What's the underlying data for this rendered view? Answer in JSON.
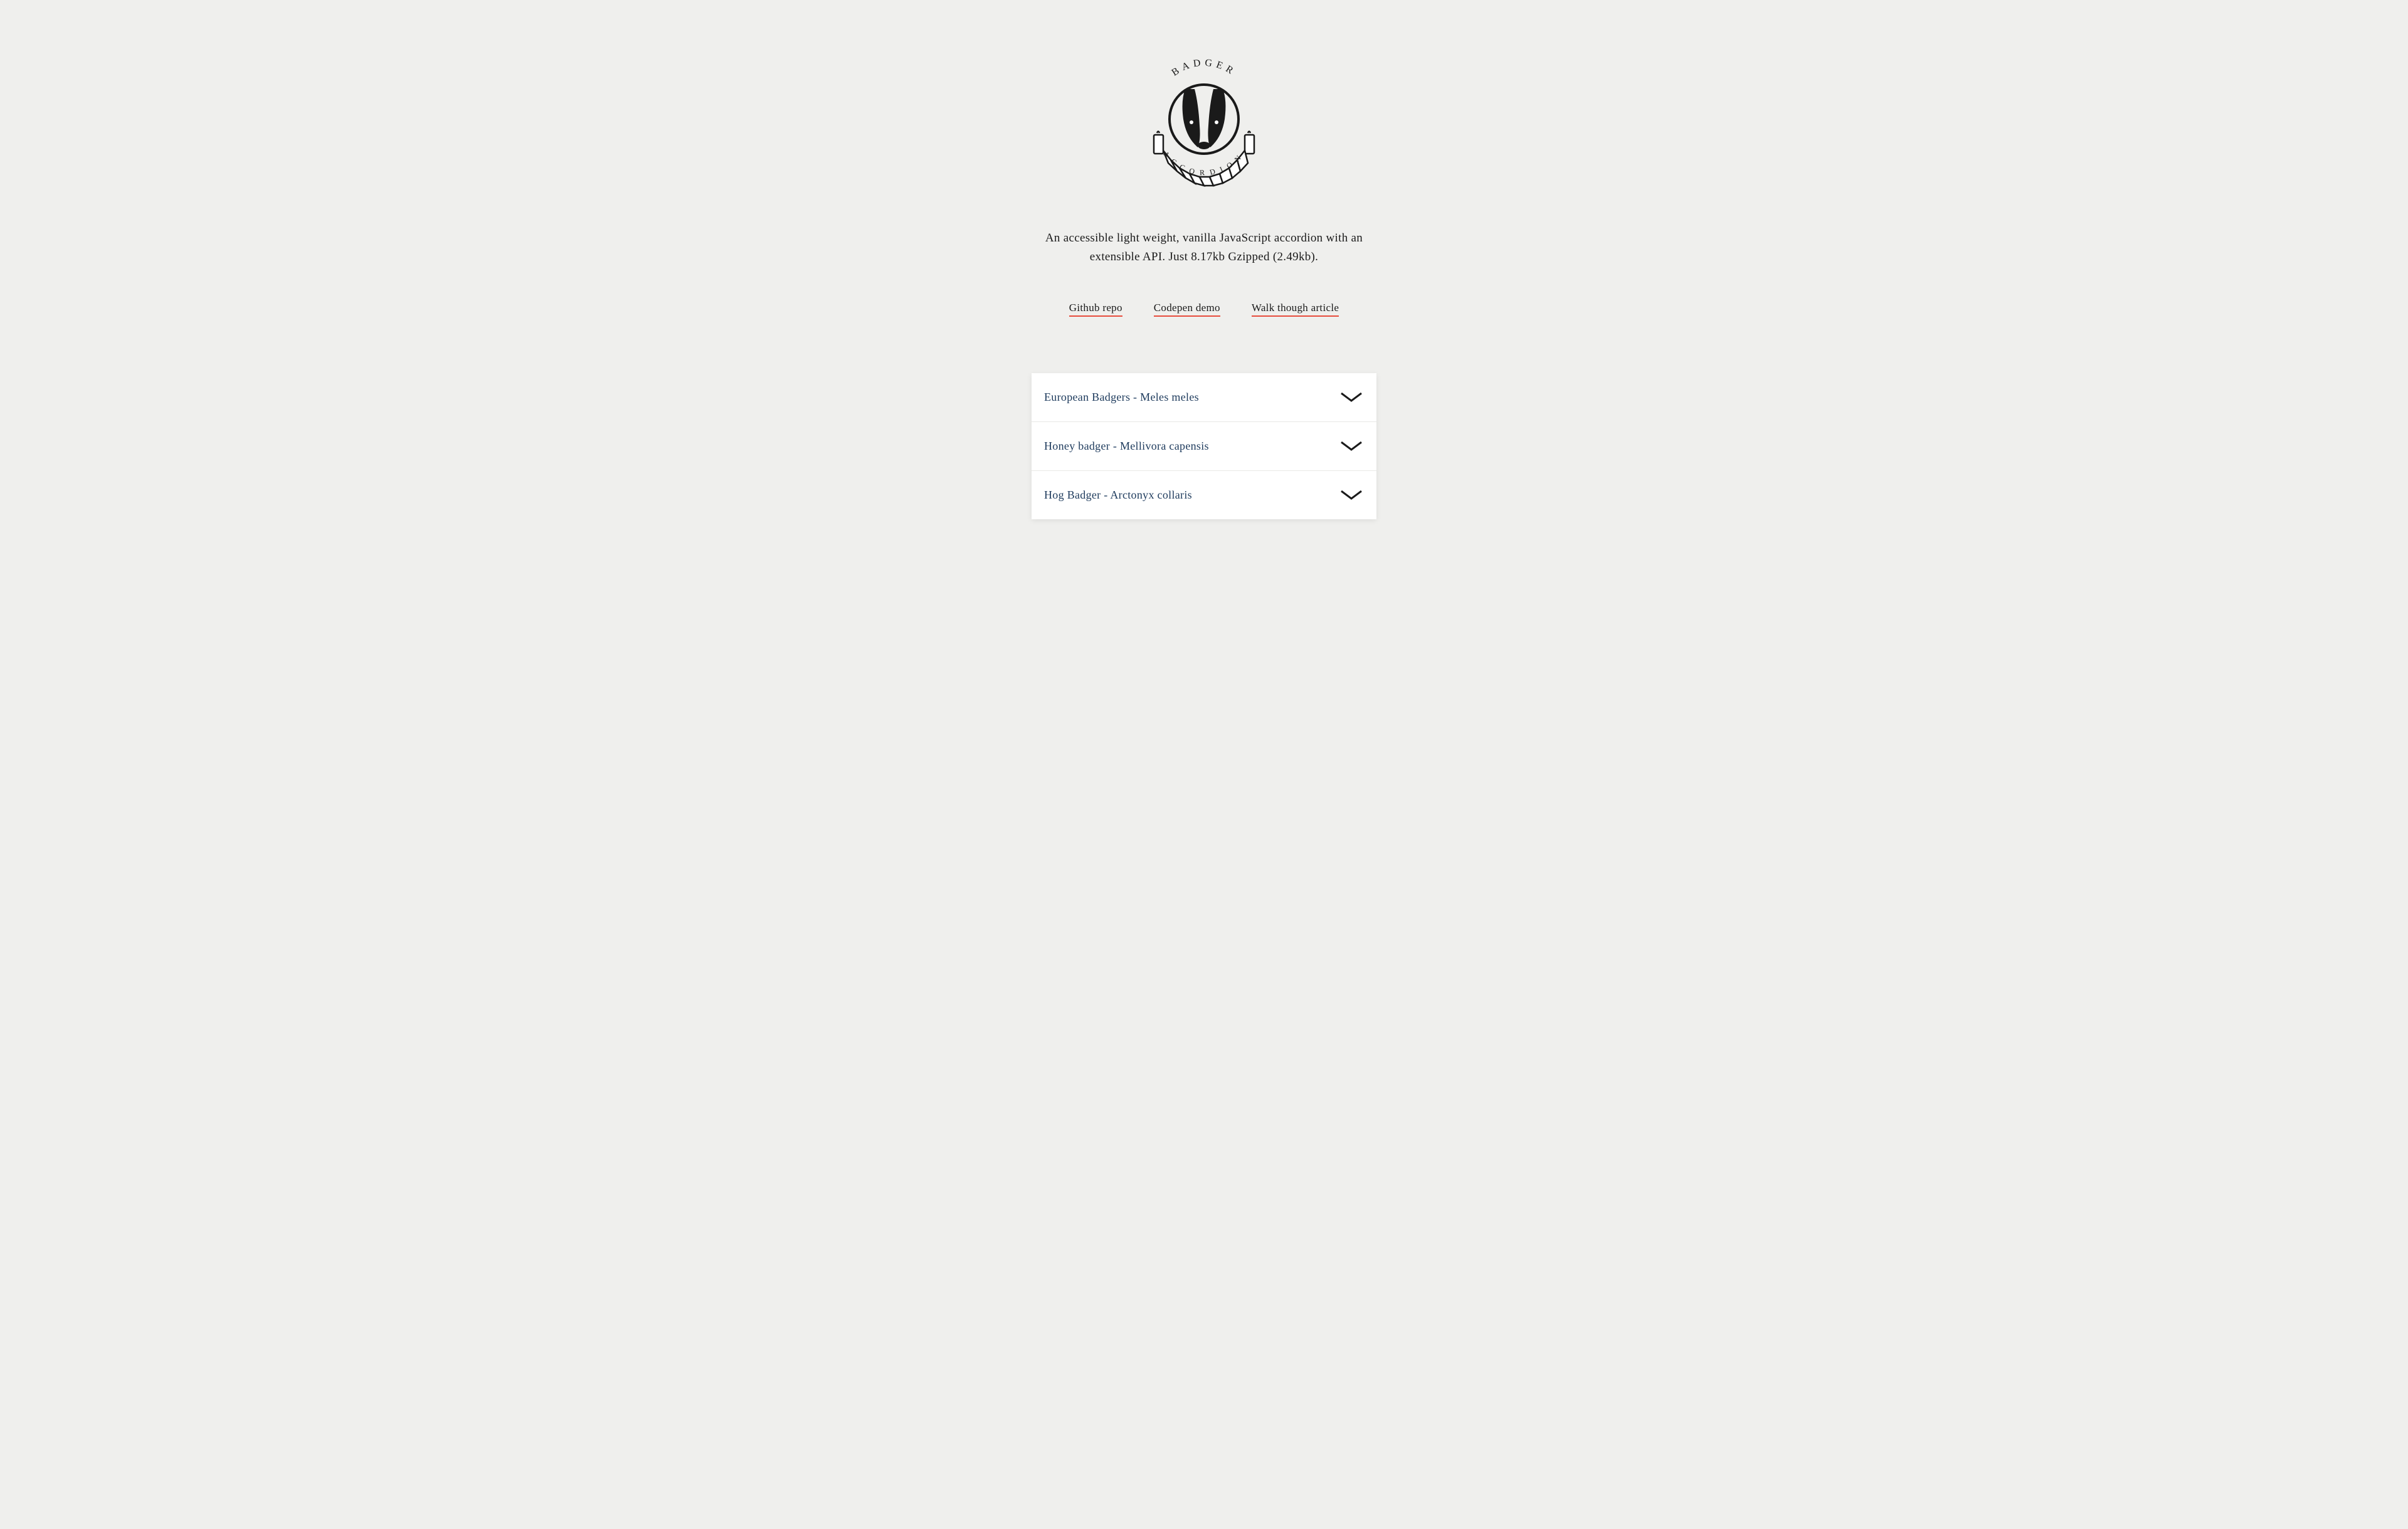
{
  "header": {
    "logo_text_top": "BADGER",
    "logo_text_bottom": "ACCORDION",
    "tagline": "An accessible light weight, vanilla JavaScript accordion with an extensible API. Just 8.17kb Gzipped (2.49kb)."
  },
  "links": [
    {
      "label": "Github repo"
    },
    {
      "label": "Codepen demo"
    },
    {
      "label": "Walk though article"
    }
  ],
  "accordion": {
    "items": [
      {
        "title": "European Badgers - Meles meles"
      },
      {
        "title": "Honey badger - Mellivora capensis"
      },
      {
        "title": "Hog Badger - Arctonyx collaris"
      }
    ]
  }
}
